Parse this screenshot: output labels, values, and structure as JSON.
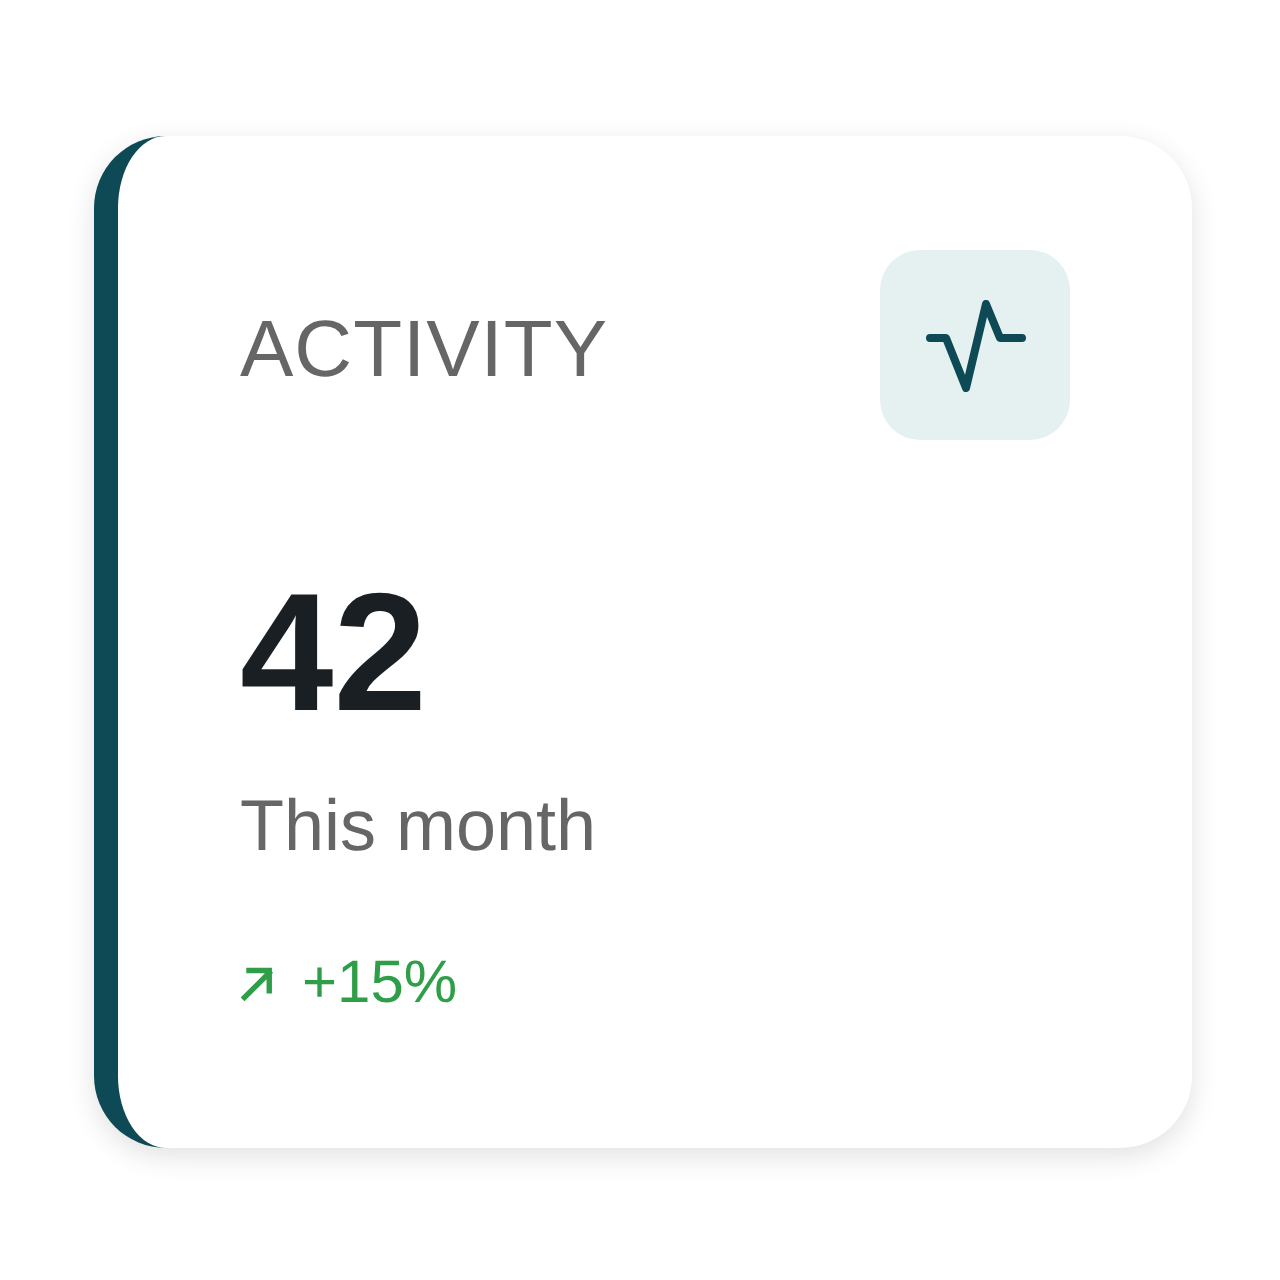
{
  "card": {
    "title": "ACTIVITY",
    "value": "42",
    "period": "This month",
    "change": {
      "text": "+15%",
      "positive": true
    }
  }
}
